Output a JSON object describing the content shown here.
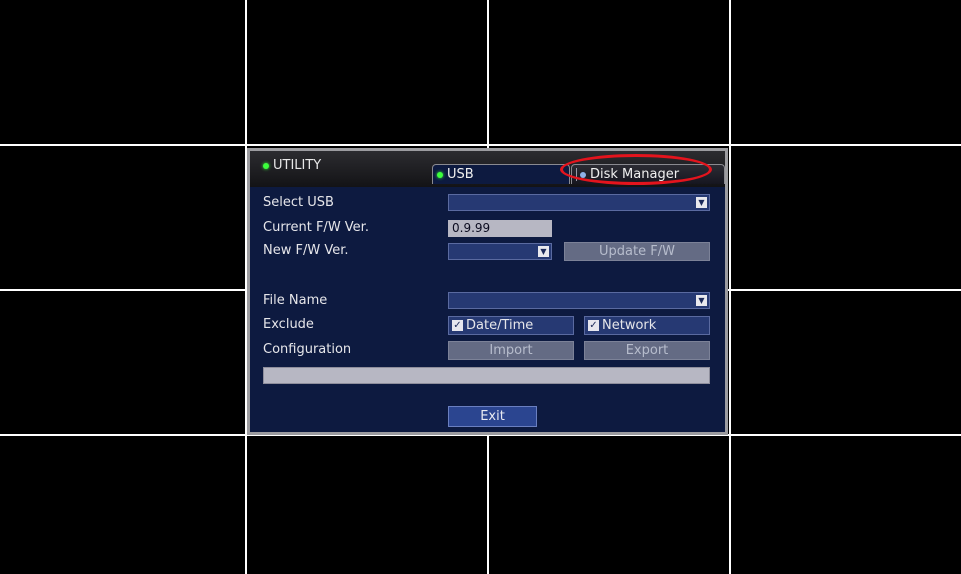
{
  "window": {
    "title": "UTILITY"
  },
  "tabs": [
    {
      "label": "USB"
    },
    {
      "label": "Disk Manager"
    }
  ],
  "form": {
    "select_usb_label": "Select USB",
    "select_usb_value": "",
    "current_fw_label": "Current F/W Ver.",
    "current_fw_value": "0.9.99",
    "new_fw_label": "New F/W Ver.",
    "new_fw_value": "",
    "update_fw_button": "Update F/W",
    "file_name_label": "File Name",
    "file_name_value": "",
    "exclude_label": "Exclude",
    "exclude_datetime": "Date/Time",
    "exclude_datetime_checked": true,
    "exclude_network": "Network",
    "exclude_network_checked": true,
    "configuration_label": "Configuration",
    "import_button": "Import",
    "export_button": "Export",
    "progress": 0,
    "exit_button": "Exit"
  },
  "colors": {
    "panel_background": "#0d1a40",
    "highlight_annotation": "#e4141d",
    "status_dot": "#3cff3c"
  },
  "icons": {
    "dropdown": "chevron-down-icon",
    "checkbox": "checkmark-icon",
    "status": "status-dot-icon"
  }
}
